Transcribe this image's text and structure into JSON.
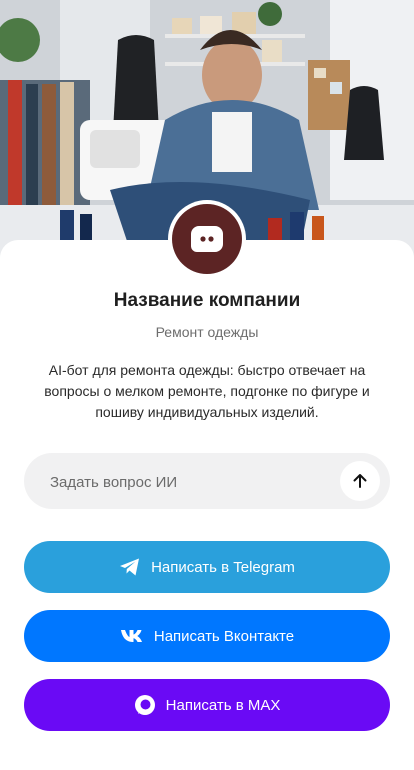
{
  "hero": {
    "alt_icon": "tailor-photo"
  },
  "company": {
    "name": "Название компании",
    "category": "Ремонт одежды",
    "description": "AI-бот для ремонта одежды: быстро отвечает на вопросы о мелком ремонте, подгонке по фигуре и пошиву индивидуальных изделий."
  },
  "ask": {
    "placeholder": "Задать вопрос ИИ",
    "send_icon": "arrow-up-icon"
  },
  "buttons": {
    "telegram": {
      "label": "Написать в Telegram",
      "color": "#2aa0dc",
      "icon": "telegram-icon"
    },
    "vk": {
      "label": "Написать Вконтакте",
      "color": "#0077ff",
      "icon": "vk-icon"
    },
    "max": {
      "label": "Написать в MAX",
      "color": "#6a0af5",
      "icon": "max-icon"
    }
  },
  "colors": {
    "avatar": "#5c2424"
  }
}
